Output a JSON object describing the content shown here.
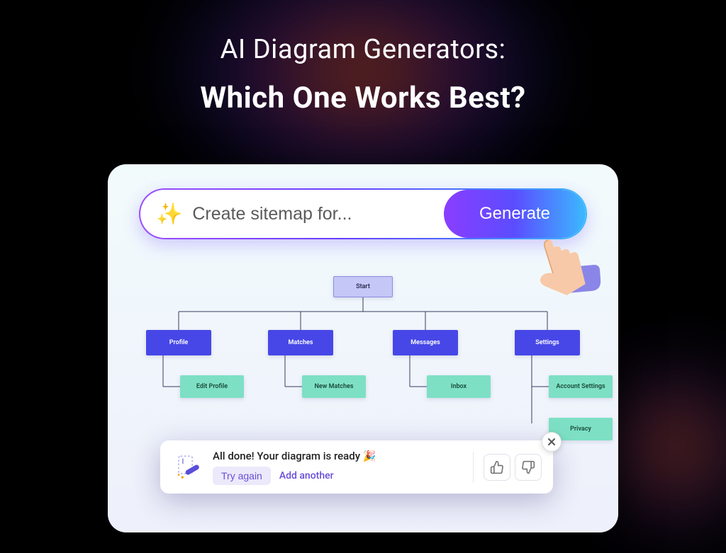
{
  "headline": {
    "top": "AI Diagram Generators:",
    "bottom": "Which One Works Best?"
  },
  "prompt": {
    "placeholder": "Create sitemap for...",
    "generate_label": "Generate"
  },
  "diagram": {
    "start": "Start",
    "categories": [
      "Profile",
      "Matches",
      "Messages",
      "Settings"
    ],
    "leaves": {
      "Profile": [
        "Edit Profile"
      ],
      "Matches": [
        "New Matches"
      ],
      "Messages": [
        "Inbox"
      ],
      "Settings": [
        "Account Settings",
        "Privacy"
      ]
    }
  },
  "toast": {
    "message": "All done! Your diagram is ready 🎉",
    "try_again": "Try again",
    "add_another": "Add another"
  }
}
